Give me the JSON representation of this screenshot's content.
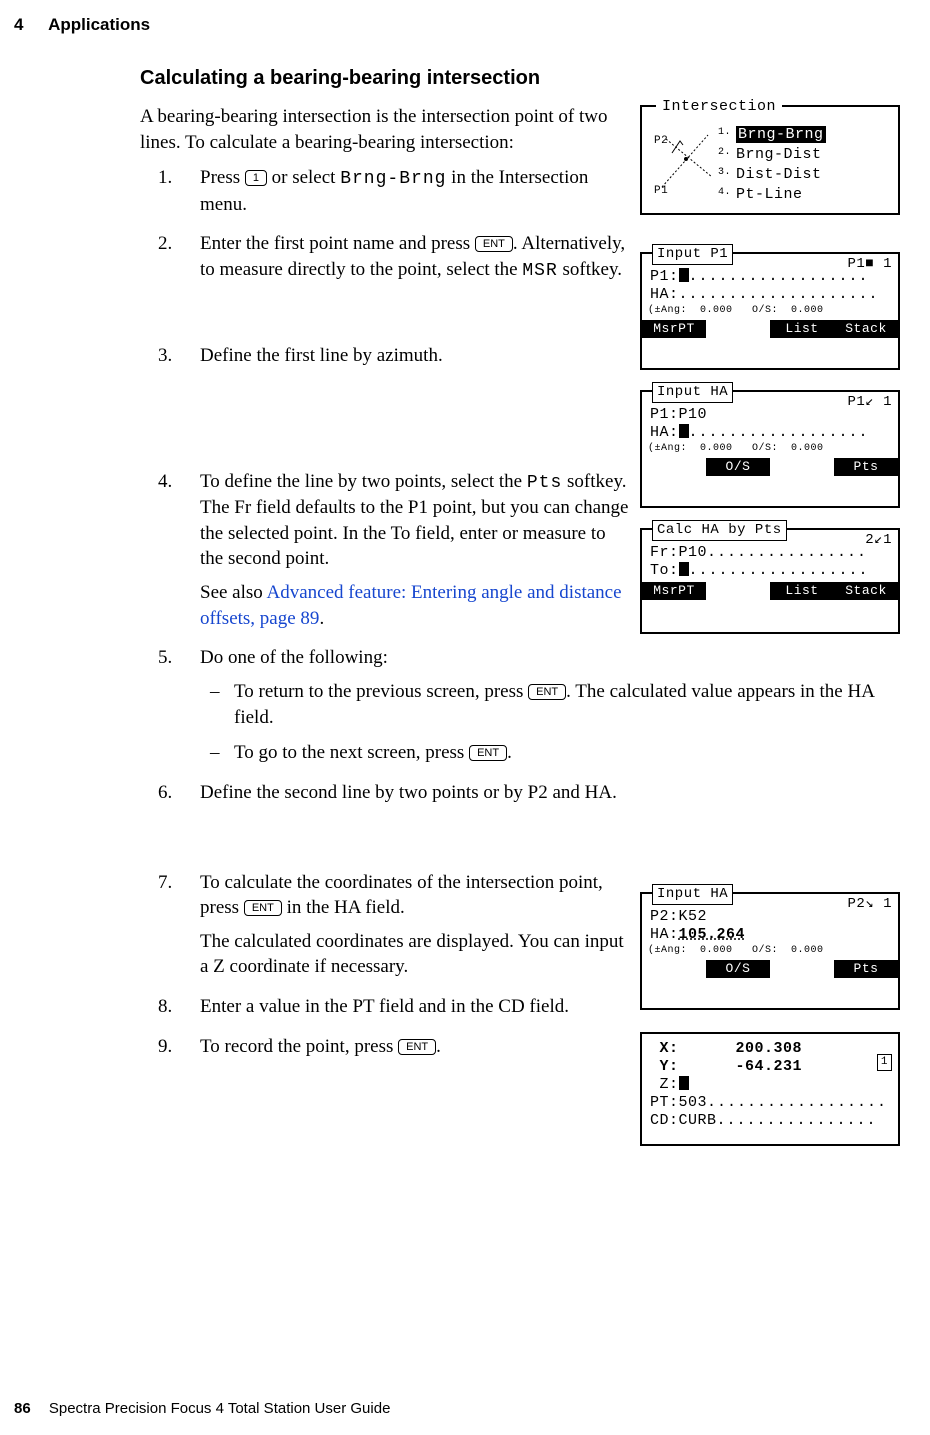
{
  "page": {
    "chapter_number": "4",
    "chapter_title": "Applications",
    "page_number": "86",
    "footer_title": "Spectra Precision Focus 4 Total Station User Guide",
    "section_heading": "Calculating a bearing-bearing intersection",
    "intro": "A bearing-bearing intersection is the intersection point of two lines. To calculate a bearing-bearing intersection:"
  },
  "keys": {
    "one": "1",
    "ent": "ENT"
  },
  "mono": {
    "brng_brng": "Brng-Brng",
    "msr": "MSR",
    "pts": "Pts"
  },
  "xref": {
    "text": "Advanced feature: Entering angle and distance offsets, page 89"
  },
  "steps": {
    "s1a": "Press ",
    "s1b": " or select ",
    "s1c": " in the Intersection menu.",
    "s2a": "Enter the first point name and press ",
    "s2b": ". Alternatively, to measure directly to the point, select the ",
    "s2c": " softkey.",
    "s3": "Define the first line by azimuth.",
    "s4a": "To define the line by two points, select the ",
    "s4b": " softkey. The Fr field defaults to the P1 point, but you can change the selected point. In the To field, enter or measure to the second point.",
    "s4see": "See also ",
    "s4dot": ".",
    "s5": "Do one of the following:",
    "s5d1a": "To return to the previous screen, press ",
    "s5d1b": ". The calculated value appears in the HA field.",
    "s5d2a": "To go to the next screen, press ",
    "s5d2b": ".",
    "s6": "Define the second line by two points or by P2 and HA.",
    "s7a": "To calculate the coordinates of the intersection point, press ",
    "s7b": " in the HA field.",
    "s7c": "The calculated coordinates are displayed. You can input a Z coordinate if necessary.",
    "s8": "Enter a value in the PT field and in the CD field.",
    "s9a": "To record the point, press ",
    "s9b": "."
  },
  "lcd": {
    "menu": {
      "title": "Intersection",
      "items": [
        "Brng-Brng",
        "Brng-Dist",
        "Dist-Dist",
        "Pt-Line"
      ],
      "diag_labels": {
        "p1": "P1",
        "p2": "P2"
      }
    },
    "input_p1": {
      "title": "Input P1",
      "corner": "P1■  1",
      "rows": {
        "p1": "P1:",
        "ha": "HA:"
      },
      "tiny": "(±Ang:  0.000   O/S:  0.000",
      "softkeys": [
        "MsrPT",
        "",
        "List",
        "Stack"
      ]
    },
    "input_ha1": {
      "title": "Input HA",
      "corner": "P1↙ 1",
      "rows": {
        "p1": "P1:P10",
        "ha": "HA:"
      },
      "tiny": "(±Ang:  0.000   O/S:  0.000",
      "softkeys": [
        "",
        "O/S",
        "",
        "Pts"
      ]
    },
    "calc_ha": {
      "title": "Calc HA by Pts",
      "corner": "2↙1",
      "rows": {
        "fr": "Fr:P10",
        "to": "To:"
      },
      "softkeys": [
        "MsrPT",
        "",
        "List",
        "Stack"
      ]
    },
    "input_ha2": {
      "title": "Input HA",
      "corner": "P2↘ 1",
      "rows": {
        "p2": "P2:K52",
        "ha": "HA:",
        "ha_val": "105.264"
      },
      "tiny": "(±Ang:  0.000   O/S:  0.000",
      "softkeys": [
        "",
        "O/S",
        "",
        "Pts"
      ]
    },
    "result": {
      "rows": {
        "x": " X:      200.308",
        "y": " Y:      -64.231",
        "z": " Z:",
        "pt": "PT:503",
        "cd": "CD:CURB"
      },
      "badge": "1"
    }
  }
}
